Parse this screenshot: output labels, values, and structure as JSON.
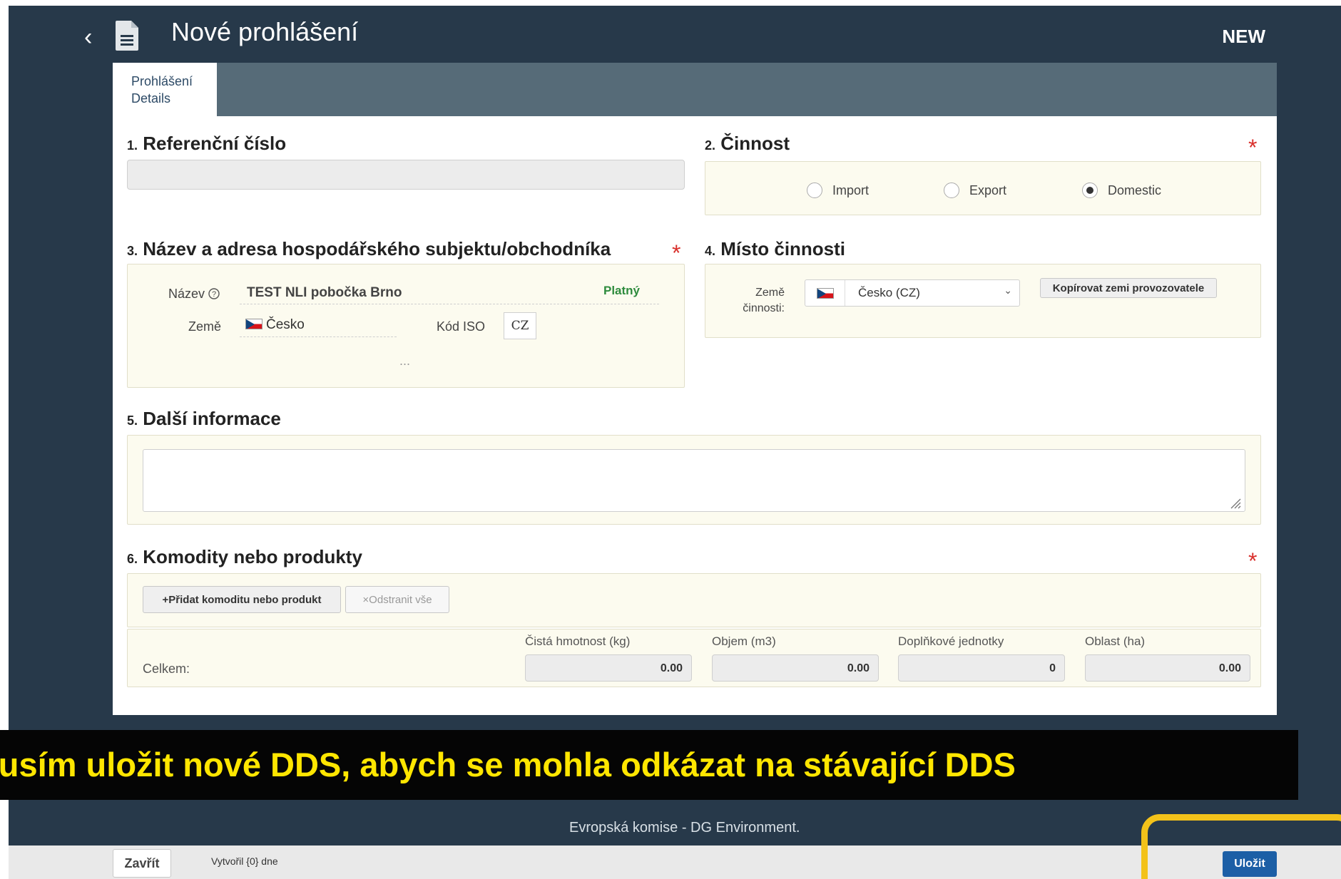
{
  "header": {
    "title": "Nové prohlášení",
    "status": "NEW"
  },
  "tabs": [
    {
      "label_line1": "Prohlášení",
      "label_line2": "Details"
    }
  ],
  "sections": {
    "reference": {
      "num": "1.",
      "title": "Referenční číslo",
      "value": ""
    },
    "activity": {
      "num": "2.",
      "title": "Činnost",
      "required": "*",
      "options": [
        "Import",
        "Export",
        "Domestic"
      ],
      "selected": "Domestic"
    },
    "operator": {
      "num": "3.",
      "title": "Název a adresa hospodářského subjektu/obchodníka",
      "required": "*",
      "name_label": "Název",
      "help_icon": "question-circle-icon",
      "name_value": "TEST NLI pobočka Brno",
      "status": "Platný",
      "country_label": "Země",
      "country_value": "Česko",
      "iso_label": "Kód ISO",
      "iso_value": "CZ",
      "more": "..."
    },
    "place": {
      "num": "4.",
      "title": "Místo činnosti",
      "country_label_line1": "Země",
      "country_label_line2": "činnosti:",
      "country_select_value": "Česko (CZ)",
      "copy_button": "Kopírovat zemi provozovatele"
    },
    "additional": {
      "num": "5.",
      "title": "Další informace",
      "value": ""
    },
    "commodities": {
      "num": "6.",
      "title": "Komodity nebo produkty",
      "required": "*",
      "add_button": "+Přidat komoditu nebo produkt",
      "remove_button": "×Odstranit vše",
      "total_label": "Celkem:",
      "columns": [
        "Čistá hmotnost (kg)",
        "Objem (m3)",
        "Doplňkové jednotky",
        "Oblast (ha)"
      ],
      "totals": [
        "0.00",
        "0.00",
        "0",
        "0.00"
      ]
    }
  },
  "banner": {
    "text": "musím uložit nové DDS, abych se mohla odkázat na stávající DDS"
  },
  "footer": {
    "credit": "Evropská komise - DG Environment."
  },
  "bottombar": {
    "close_button": "Zavřít",
    "created_text": "Vytvořil {0} dne",
    "save_button": "Uložit"
  },
  "colors": {
    "app_background": "#27394a",
    "tabbar": "#566b78",
    "required": "#d9302c",
    "valid_status": "#2e8b3d",
    "save_button": "#1c5fa6",
    "banner_text": "#ffe600",
    "highlight": "#f3c21a"
  }
}
